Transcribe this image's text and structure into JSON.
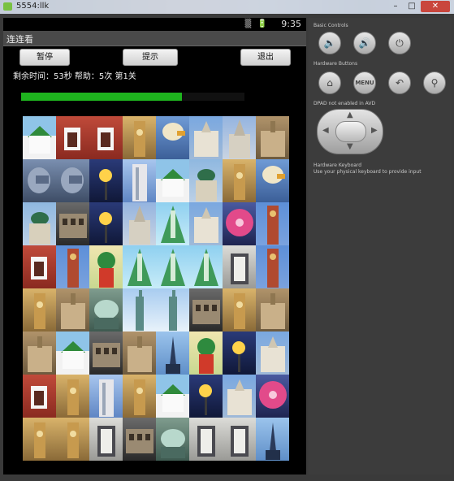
{
  "window": {
    "title": "5554:llk",
    "controls": [
      "–",
      "□",
      "✕"
    ]
  },
  "status_bar": {
    "time": "9:35",
    "icons": "▒ 🔋"
  },
  "app": {
    "title": "连连看",
    "buttons": {
      "pause": "暂停",
      "hint": "提示",
      "exit": "退出"
    },
    "info": "剩余时间：53秒 帮助：5次  第1关",
    "progress_fraction": 0.72,
    "progress_color": "#1eb41e"
  },
  "tiles": [
    [
      "house-green",
      "tower-red",
      "tower-red",
      "clocktower-gold",
      "eagle",
      "cathedral",
      "gothic-church",
      "castle"
    ],
    [
      "dragon",
      "dragon",
      "lamp-night",
      "skyscraper",
      "house-green",
      "green-dome",
      "clocktower-gold",
      "eagle"
    ],
    [
      "green-dome",
      "colosseum",
      "lamp-night",
      "gothic-church",
      "christmas-tree",
      "cathedral",
      "ferris-wheel",
      "red-tower-tall"
    ],
    [
      "tower-red",
      "red-tower-tall",
      "onion-dome",
      "christmas-tree",
      "christmas-tree",
      "christmas-tree",
      "gothic-window",
      "red-tower-tall"
    ],
    [
      "clocktower-gold",
      "castle",
      "glass-dome",
      "statue-liberty",
      "statue-liberty",
      "colosseum",
      "clocktower-gold",
      "castle"
    ],
    [
      "castle",
      "house-green",
      "colosseum",
      "castle",
      "obelisk",
      "onion-dome",
      "lamp-night",
      "cathedral"
    ],
    [
      "tower-red",
      "clocktower-gold",
      "skyscraper",
      "clocktower-gold",
      "house-green",
      "lamp-night",
      "cathedral",
      "ferris-wheel"
    ],
    [
      "clocktower-gold",
      "clocktower-gold",
      "gothic-window",
      "colosseum",
      "glass-dome",
      "gothic-window",
      "gothic-window",
      "obelisk"
    ]
  ],
  "side_panel": {
    "basic_controls_label": "Basic Controls",
    "hardware_buttons_label": "Hardware Buttons",
    "dpad_label": "DPAD not enabled in AVD",
    "keyboard_label": "Hardware Keyboard",
    "keyboard_hint": "Use your physical keyboard to provide input",
    "menu_label": "MENU",
    "icons": {
      "vol_down": "🔈",
      "vol_up": "🔊",
      "power": "⏻",
      "home": "⌂",
      "back": "↶",
      "search": "⚲"
    }
  }
}
